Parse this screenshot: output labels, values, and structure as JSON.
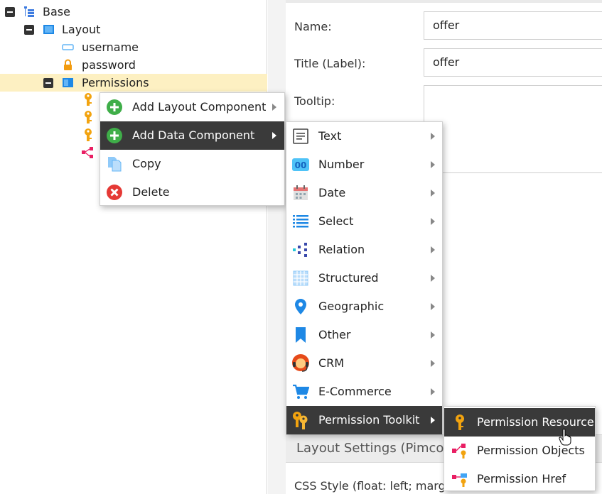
{
  "tree": {
    "nodes": [
      {
        "label": "Base"
      },
      {
        "label": "Layout"
      },
      {
        "label": "username"
      },
      {
        "label": "password"
      },
      {
        "label": "Permissions"
      }
    ]
  },
  "form": {
    "name_label": "Name:",
    "name_value": "offer",
    "title_label": "Title (Label):",
    "title_value": "offer",
    "tooltip_label": "Tooltip:",
    "layout_settings_title": "Layout Settings (Pimco",
    "css_style_label": "CSS Style (float: left; margin:"
  },
  "context_menu": {
    "items": [
      {
        "label": "Add Layout Component",
        "icon": "plus-circle-green-icon",
        "submenu": true
      },
      {
        "label": "Add Data Component",
        "icon": "plus-circle-green-icon",
        "submenu": true
      },
      {
        "label": "Copy",
        "icon": "copy-icon",
        "submenu": false
      },
      {
        "label": "Delete",
        "icon": "delete-red-circle-icon",
        "submenu": false
      }
    ]
  },
  "data_component_menu": {
    "items": [
      {
        "label": "Text",
        "icon": "text-icon"
      },
      {
        "label": "Number",
        "icon": "number-icon"
      },
      {
        "label": "Date",
        "icon": "calendar-icon"
      },
      {
        "label": "Select",
        "icon": "list-icon"
      },
      {
        "label": "Relation",
        "icon": "relation-icon"
      },
      {
        "label": "Structured",
        "icon": "grid-icon"
      },
      {
        "label": "Geographic",
        "icon": "map-pin-icon"
      },
      {
        "label": "Other",
        "icon": "bookmark-icon"
      },
      {
        "label": "CRM",
        "icon": "support-agent-icon"
      },
      {
        "label": "E-Commerce",
        "icon": "shopping-cart-icon"
      },
      {
        "label": "Permission Toolkit",
        "icon": "keys-icon"
      }
    ]
  },
  "permission_toolkit_menu": {
    "items": [
      {
        "label": "Permission Resource",
        "icon": "key-icon"
      },
      {
        "label": "Permission Objects",
        "icon": "permission-objects-icon"
      },
      {
        "label": "Permission Href",
        "icon": "permission-href-icon"
      }
    ]
  },
  "colors": {
    "selected_row": "#fdf0c2",
    "active_menu_item": "#3a3a3a",
    "key_orange": "#f2a30f",
    "add_green": "#3fae49",
    "delete_red": "#e53935"
  }
}
